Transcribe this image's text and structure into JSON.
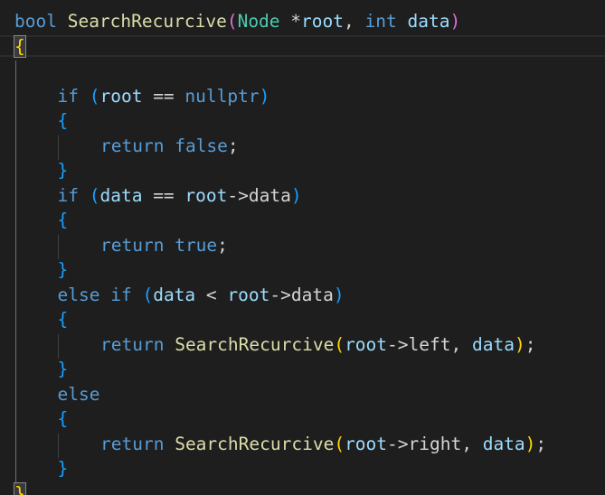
{
  "editor": {
    "lines": [
      {
        "indent": 0,
        "tokens": [
          {
            "t": "bool",
            "c": "kw"
          },
          {
            "t": " ",
            "c": "punc"
          },
          {
            "t": "SearchRecurcive",
            "c": "fn"
          },
          {
            "t": "(",
            "c": "paren1"
          },
          {
            "t": "Node",
            "c": "ty"
          },
          {
            "t": " ",
            "c": "punc"
          },
          {
            "t": "*",
            "c": "punc"
          },
          {
            "t": "root",
            "c": "param"
          },
          {
            "t": ", ",
            "c": "punc"
          },
          {
            "t": "int",
            "c": "kw"
          },
          {
            "t": " ",
            "c": "punc"
          },
          {
            "t": "data",
            "c": "param"
          },
          {
            "t": ")",
            "c": "paren1"
          }
        ]
      },
      {
        "indent": 0,
        "tokens": [
          {
            "t": "{",
            "c": "paren3 brace-match"
          }
        ]
      },
      {
        "indent": 0,
        "tokens": []
      },
      {
        "indent": 1,
        "tokens": [
          {
            "t": "if",
            "c": "kw"
          },
          {
            "t": " ",
            "c": "punc"
          },
          {
            "t": "(",
            "c": "paren2"
          },
          {
            "t": "root",
            "c": "param"
          },
          {
            "t": " == ",
            "c": "punc"
          },
          {
            "t": "nullptr",
            "c": "kw"
          },
          {
            "t": ")",
            "c": "paren2"
          }
        ]
      },
      {
        "indent": 1,
        "tokens": [
          {
            "t": "{",
            "c": "paren2"
          }
        ]
      },
      {
        "indent": 2,
        "tokens": [
          {
            "t": "return",
            "c": "kw"
          },
          {
            "t": " ",
            "c": "punc"
          },
          {
            "t": "false",
            "c": "kw"
          },
          {
            "t": ";",
            "c": "punc"
          }
        ]
      },
      {
        "indent": 1,
        "tokens": [
          {
            "t": "}",
            "c": "paren2"
          }
        ]
      },
      {
        "indent": 1,
        "tokens": [
          {
            "t": "if",
            "c": "kw"
          },
          {
            "t": " ",
            "c": "punc"
          },
          {
            "t": "(",
            "c": "paren2"
          },
          {
            "t": "data",
            "c": "param"
          },
          {
            "t": " == ",
            "c": "punc"
          },
          {
            "t": "root",
            "c": "param"
          },
          {
            "t": "->",
            "c": "punc"
          },
          {
            "t": "data",
            "c": "punc"
          },
          {
            "t": ")",
            "c": "paren2"
          }
        ]
      },
      {
        "indent": 1,
        "tokens": [
          {
            "t": "{",
            "c": "paren2"
          }
        ]
      },
      {
        "indent": 2,
        "tokens": [
          {
            "t": "return",
            "c": "kw"
          },
          {
            "t": " ",
            "c": "punc"
          },
          {
            "t": "true",
            "c": "kw"
          },
          {
            "t": ";",
            "c": "punc"
          }
        ]
      },
      {
        "indent": 1,
        "tokens": [
          {
            "t": "}",
            "c": "paren2"
          }
        ]
      },
      {
        "indent": 1,
        "tokens": [
          {
            "t": "else",
            "c": "kw"
          },
          {
            "t": " ",
            "c": "punc"
          },
          {
            "t": "if",
            "c": "kw"
          },
          {
            "t": " ",
            "c": "punc"
          },
          {
            "t": "(",
            "c": "paren2"
          },
          {
            "t": "data",
            "c": "param"
          },
          {
            "t": " < ",
            "c": "punc"
          },
          {
            "t": "root",
            "c": "param"
          },
          {
            "t": "->",
            "c": "punc"
          },
          {
            "t": "data",
            "c": "punc"
          },
          {
            "t": ")",
            "c": "paren2"
          }
        ]
      },
      {
        "indent": 1,
        "tokens": [
          {
            "t": "{",
            "c": "paren2"
          }
        ]
      },
      {
        "indent": 2,
        "tokens": [
          {
            "t": "return",
            "c": "kw"
          },
          {
            "t": " ",
            "c": "punc"
          },
          {
            "t": "SearchRecurcive",
            "c": "fn"
          },
          {
            "t": "(",
            "c": "paren3"
          },
          {
            "t": "root",
            "c": "param"
          },
          {
            "t": "->",
            "c": "punc"
          },
          {
            "t": "left",
            "c": "punc"
          },
          {
            "t": ", ",
            "c": "punc"
          },
          {
            "t": "data",
            "c": "param"
          },
          {
            "t": ")",
            "c": "paren3"
          },
          {
            "t": ";",
            "c": "punc"
          }
        ]
      },
      {
        "indent": 1,
        "tokens": [
          {
            "t": "}",
            "c": "paren2"
          }
        ]
      },
      {
        "indent": 1,
        "tokens": [
          {
            "t": "else",
            "c": "kw"
          }
        ]
      },
      {
        "indent": 1,
        "tokens": [
          {
            "t": "{",
            "c": "paren2"
          }
        ]
      },
      {
        "indent": 2,
        "tokens": [
          {
            "t": "return",
            "c": "kw"
          },
          {
            "t": " ",
            "c": "punc"
          },
          {
            "t": "SearchRecurcive",
            "c": "fn"
          },
          {
            "t": "(",
            "c": "paren3"
          },
          {
            "t": "root",
            "c": "param"
          },
          {
            "t": "->",
            "c": "punc"
          },
          {
            "t": "right",
            "c": "punc"
          },
          {
            "t": ", ",
            "c": "punc"
          },
          {
            "t": "data",
            "c": "param"
          },
          {
            "t": ")",
            "c": "paren3"
          },
          {
            "t": ";",
            "c": "punc"
          }
        ]
      },
      {
        "indent": 1,
        "tokens": [
          {
            "t": "}",
            "c": "paren2"
          }
        ]
      },
      {
        "indent": 0,
        "tokens": [
          {
            "t": "}",
            "c": "paren3 brace-match"
          }
        ]
      }
    ]
  }
}
